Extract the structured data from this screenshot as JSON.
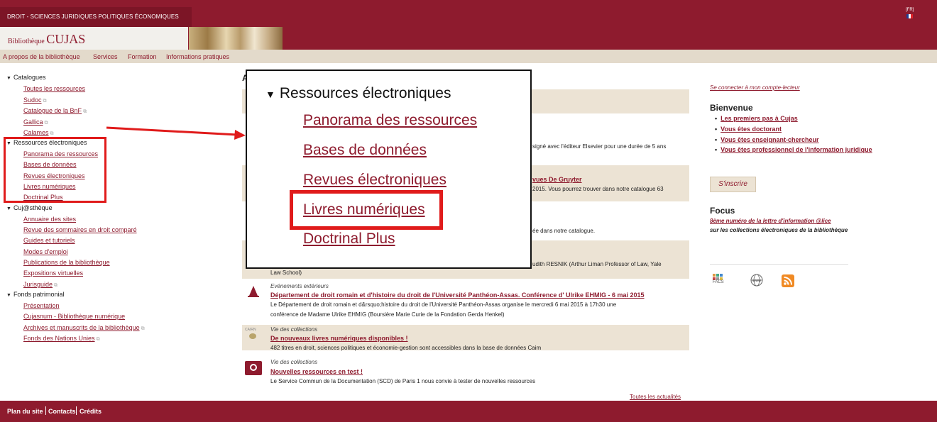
{
  "header": {
    "university": "DROIT - SCIENCES JURIDIQUES POLITIQUES ÉCONOMIQUES",
    "library_prefix": "Bibliothèque",
    "library_name": "CUJAS",
    "lang_label": "[FR]",
    "colors": {
      "primary": "#8e1b2e",
      "nav_bg": "#e3dacb",
      "band_bg": "#ece3d4"
    }
  },
  "nav": {
    "items": [
      "A propos de la bibliothèque",
      "Services",
      "Formation",
      "Informations pratiques"
    ]
  },
  "sidebar": {
    "sections": [
      {
        "title": "Catalogues",
        "items": [
          "Toutes les ressources",
          "Sudoc",
          "Catalogue de la BnF",
          "Gallica",
          "Calames"
        ]
      },
      {
        "title": "Ressources électroniques",
        "items": [
          "Panorama des ressources",
          "Bases de données",
          "Revues électroniques",
          "Livres numériques",
          "Doctrinal Plus"
        ]
      },
      {
        "title": "Cuj@sthèque",
        "items": [
          "Annuaire des sites",
          "Revue des sommaires en droit comparé",
          "Guides et tutoriels",
          "Modes d'emploi",
          "Publications de la bibliothèque",
          "Expositions virtuelles",
          "Jurisguide"
        ]
      },
      {
        "title": "Fonds patrimonial",
        "items": [
          "Présentation",
          "Cujasnum - Bibliothèque numérique",
          "Archives et manuscrits de la bibliothèque",
          "Fonds des Nations Unies"
        ]
      }
    ]
  },
  "zoom": {
    "title": "Ressources électroniques",
    "items": [
      "Panorama des ressources",
      "Bases de données",
      "Revues électroniques",
      "Livres numériques",
      "Doctrinal Plus"
    ]
  },
  "content": {
    "heading_letter": "A",
    "fragments": {
      "elsevier": "signé avec l'éditeur Elsevier pour une durée de 5 ans",
      "gruyter_title": "vues De Gruyter",
      "gruyter_text": "2015. Vous pourrez trouver dans notre catalogue 63",
      "catalogue": "ée dans notre catalogue.",
      "resnik": "udith RESNIK (Arthur Liman Professor of Law, Yale",
      "resnik_cont": "Law School)"
    },
    "news": [
      {
        "category": "Evénements extérieurs",
        "title": "Département de droit romain et d'histoire du droit de l'Université Panthéon-Assas. Conférence d' Ulrike EHMIG - 6 mai 2015",
        "text1": "Le Département de droit romain et d&rsquo;histoire du droit de l'Université Panthéon-Assas organise le mercredi 6 mai 2015 à 17h30 une",
        "text2": "conférence de Madame Ulrike EHMIG (Boursière Marie Curie de la Fondation Gerda Henkel)"
      },
      {
        "category": "Vie des collections",
        "title": "De nouveaux livres numériques disponibles !",
        "text1": "482 titres en droit, sciences politiques et économie-gestion sont accessibles dans la base de données Caim",
        "thumb_label": "CAIRN"
      },
      {
        "category": "Vie des collections",
        "title": "Nouvelles ressources en test !",
        "text1": "Le Service Commun de la Documentation (SCD) de Paris 1 nous convie à tester de nouvelles ressources"
      }
    ],
    "all_news": "Toutes les actualités"
  },
  "right": {
    "login": "Se connecter à mon compte-lecteur",
    "welcome_title": "Bienvenue",
    "welcome_items": [
      "Les premiers pas à Cujas",
      "Vous êtes doctorant",
      "Vous êtes enseignant-chercheur",
      "Vous êtes professionnel de l'information juridique"
    ],
    "subscribe": "S'inscrire",
    "focus_title": "Focus",
    "focus_link": "8ème numéro de la lettre d'information @lice",
    "focus_text": "sur les collections électroniques de la bibliothèque",
    "icons": {
      "facs_label": "FACS",
      "www_label": "www"
    }
  },
  "footer": {
    "items": [
      "Plan du site",
      "Contacts",
      "Crédits"
    ]
  }
}
